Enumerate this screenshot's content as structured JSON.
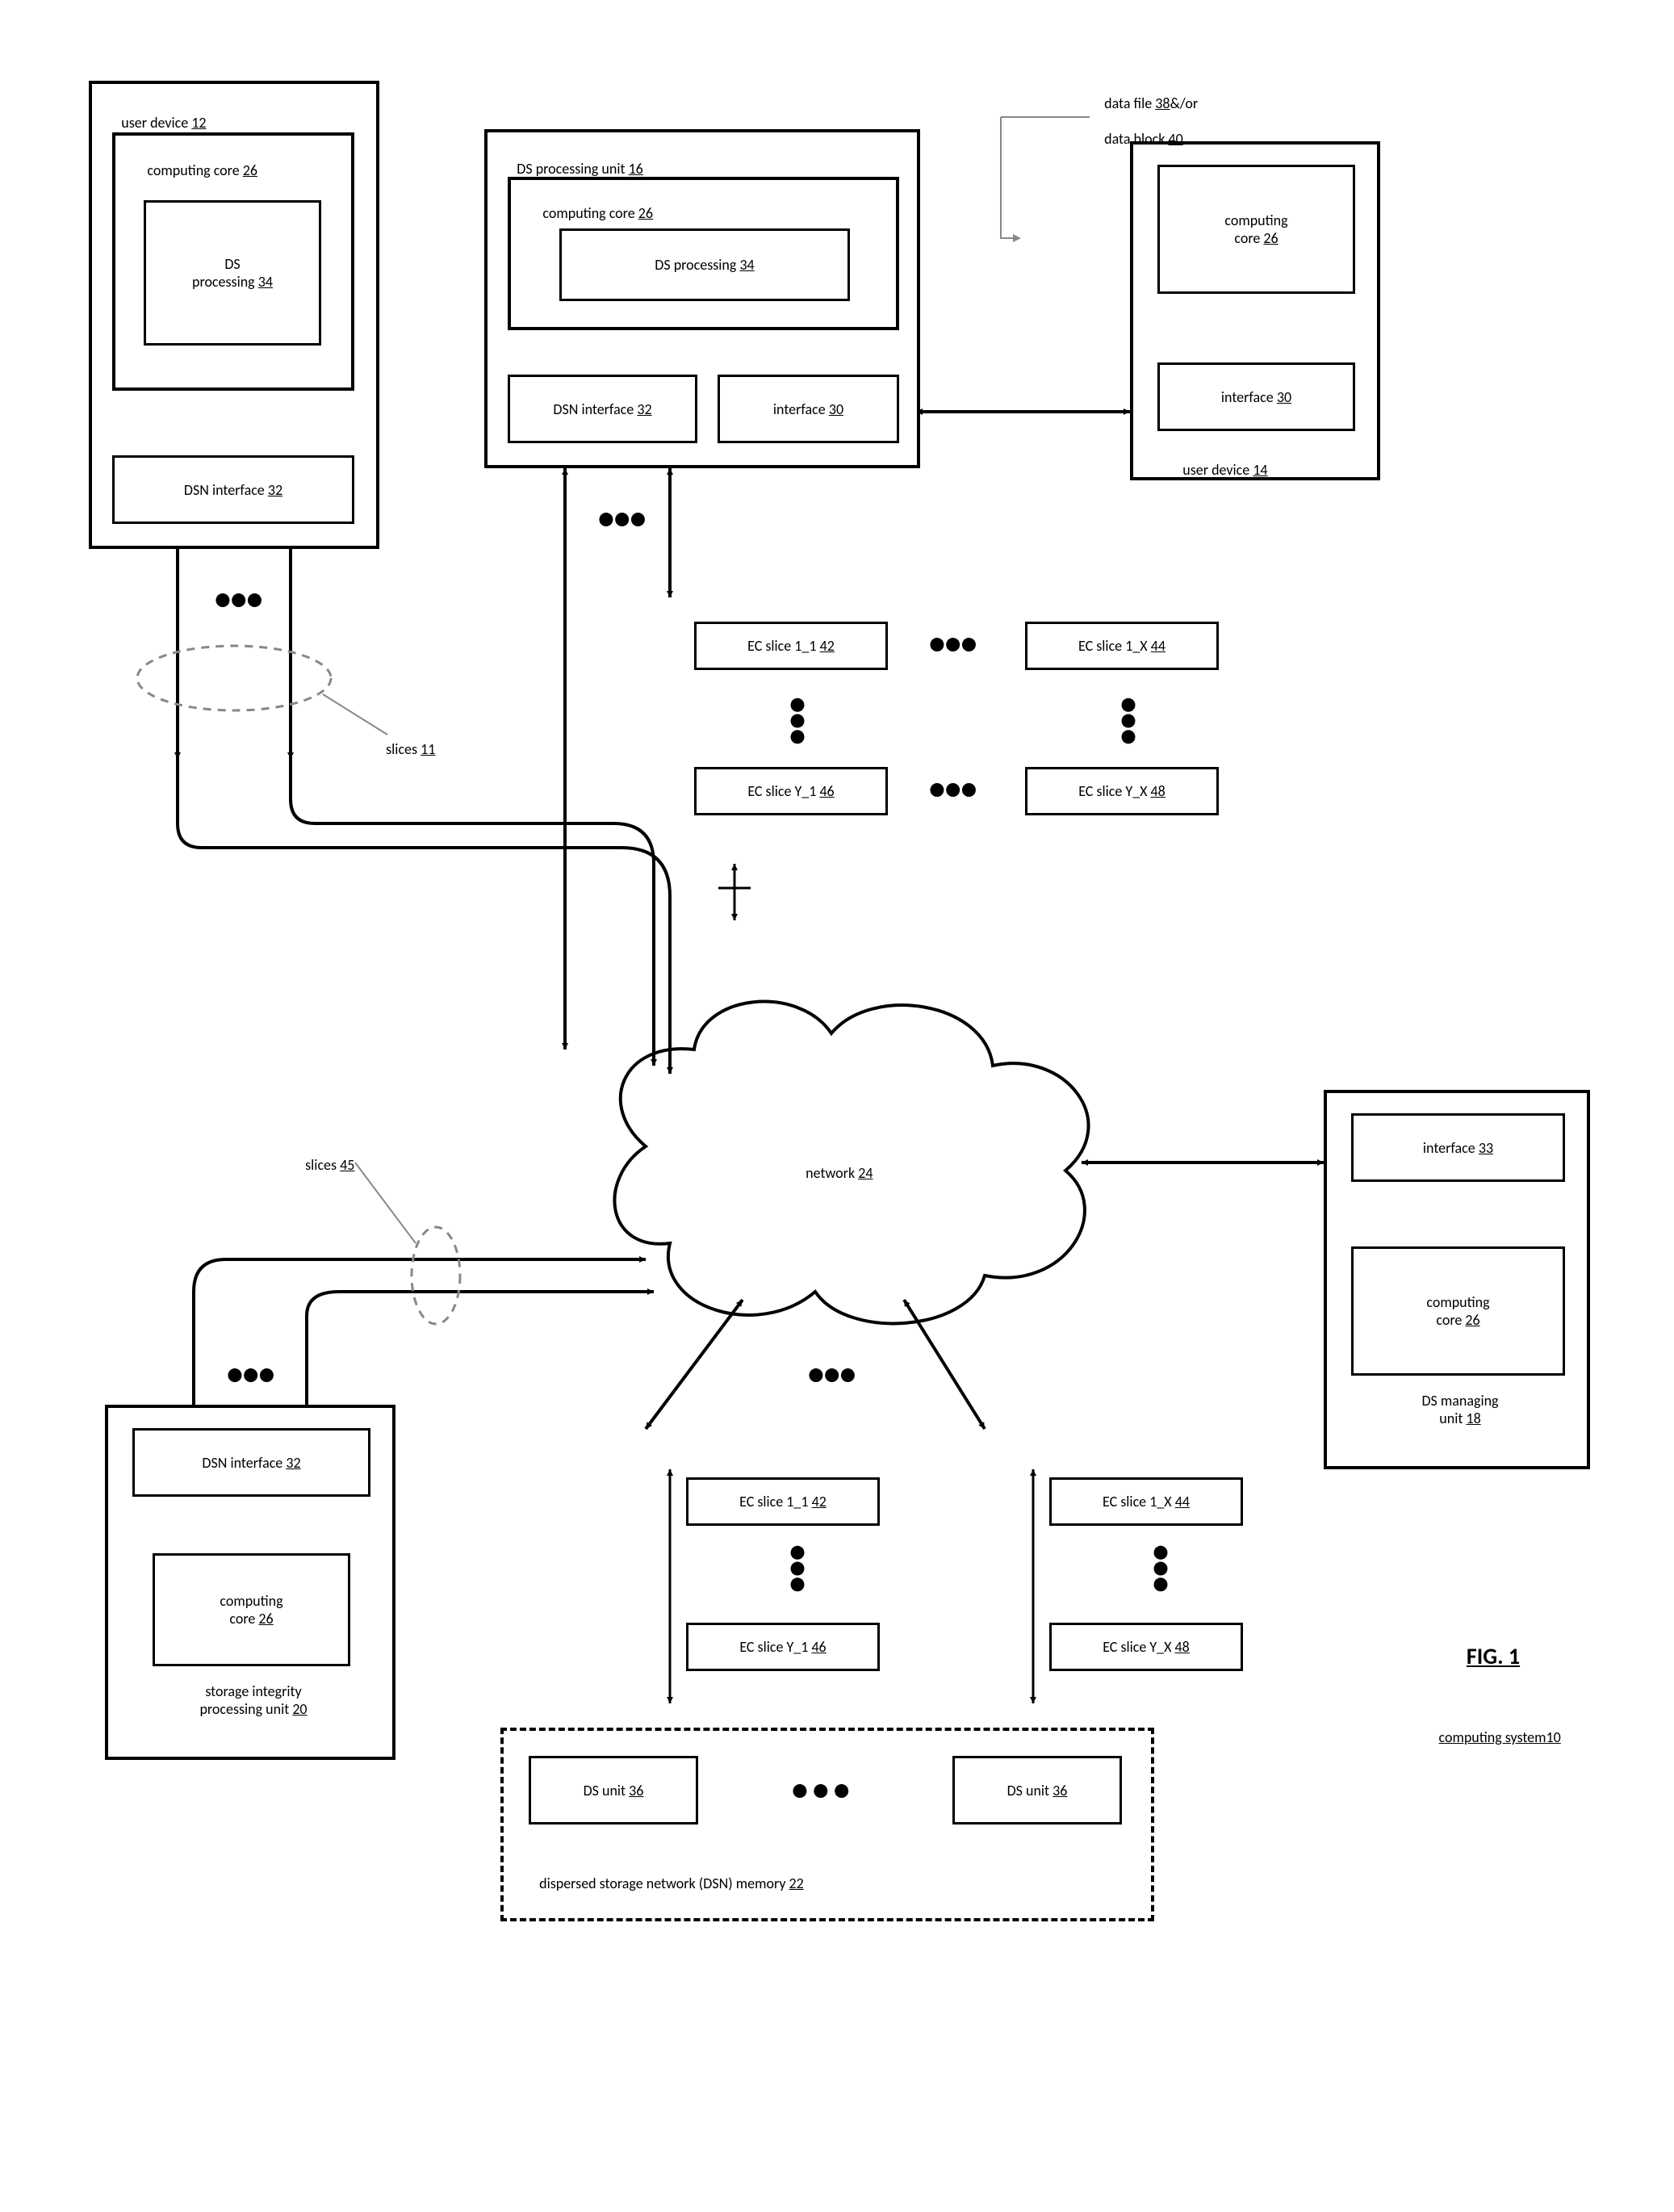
{
  "figure": {
    "title": "FIG. 1",
    "subtitle_text": "computing system",
    "subtitle_num": "10"
  },
  "user_device_12": {
    "title_text": "user device",
    "title_num": "12",
    "cc_text": "computing core",
    "cc_num": "26",
    "dsp_text": "DS\nprocessing",
    "dsp_num": "34",
    "dsn_if_text": "DSN interface",
    "dsn_if_num": "32"
  },
  "ds_proc_unit": {
    "title_text": "DS processing unit",
    "title_num": "16",
    "cc_text": "computing core",
    "cc_num": "26",
    "dsp_text": "DS processing",
    "dsp_num": "34",
    "dsn_if_text": "DSN interface",
    "dsn_if_num": "32",
    "if_text": "interface",
    "if_num": "30"
  },
  "user_device_14": {
    "title_text": "user device",
    "title_num": "14",
    "cc_text": "computing\ncore",
    "cc_num": "26",
    "if_text": "interface",
    "if_num": "30"
  },
  "data_label": "data file 38&/or\ndata block 40",
  "data_label_nums_a": "38",
  "data_label_nums_b": "40",
  "slices_11_text": "slices",
  "slices_11_num": "11",
  "slices_45_text": "slices",
  "slices_45_num": "45",
  "ec_upper": {
    "a_text": "EC slice 1_1",
    "a_num": "42",
    "b_text": "EC slice 1_X",
    "b_num": "44",
    "c_text": "EC slice Y_1",
    "c_num": "46",
    "d_text": "EC slice Y_X",
    "d_num": "48"
  },
  "ec_lower": {
    "a_text": "EC slice 1_1",
    "a_num": "42",
    "b_text": "EC slice 1_X",
    "b_num": "44",
    "c_text": "EC slice Y_1",
    "c_num": "46",
    "d_text": "EC slice Y_X",
    "d_num": "48"
  },
  "network_text": "network",
  "network_num": "24",
  "ds_managing": {
    "title_text": "DS managing\nunit",
    "title_num": "18",
    "if_text": "interface",
    "if_num": "33",
    "cc_text": "computing\ncore",
    "cc_num": "26"
  },
  "storage_integrity": {
    "title_text": "storage integrity\nprocessing unit",
    "title_num": "20",
    "dsn_if_text": "DSN interface",
    "dsn_if_num": "32",
    "cc_text": "computing\ncore",
    "cc_num": "26"
  },
  "dsn_memory": {
    "title_text": "dispersed storage network (DSN) memory",
    "title_num": "22",
    "unit_text": "DS unit",
    "unit_num": "36"
  }
}
